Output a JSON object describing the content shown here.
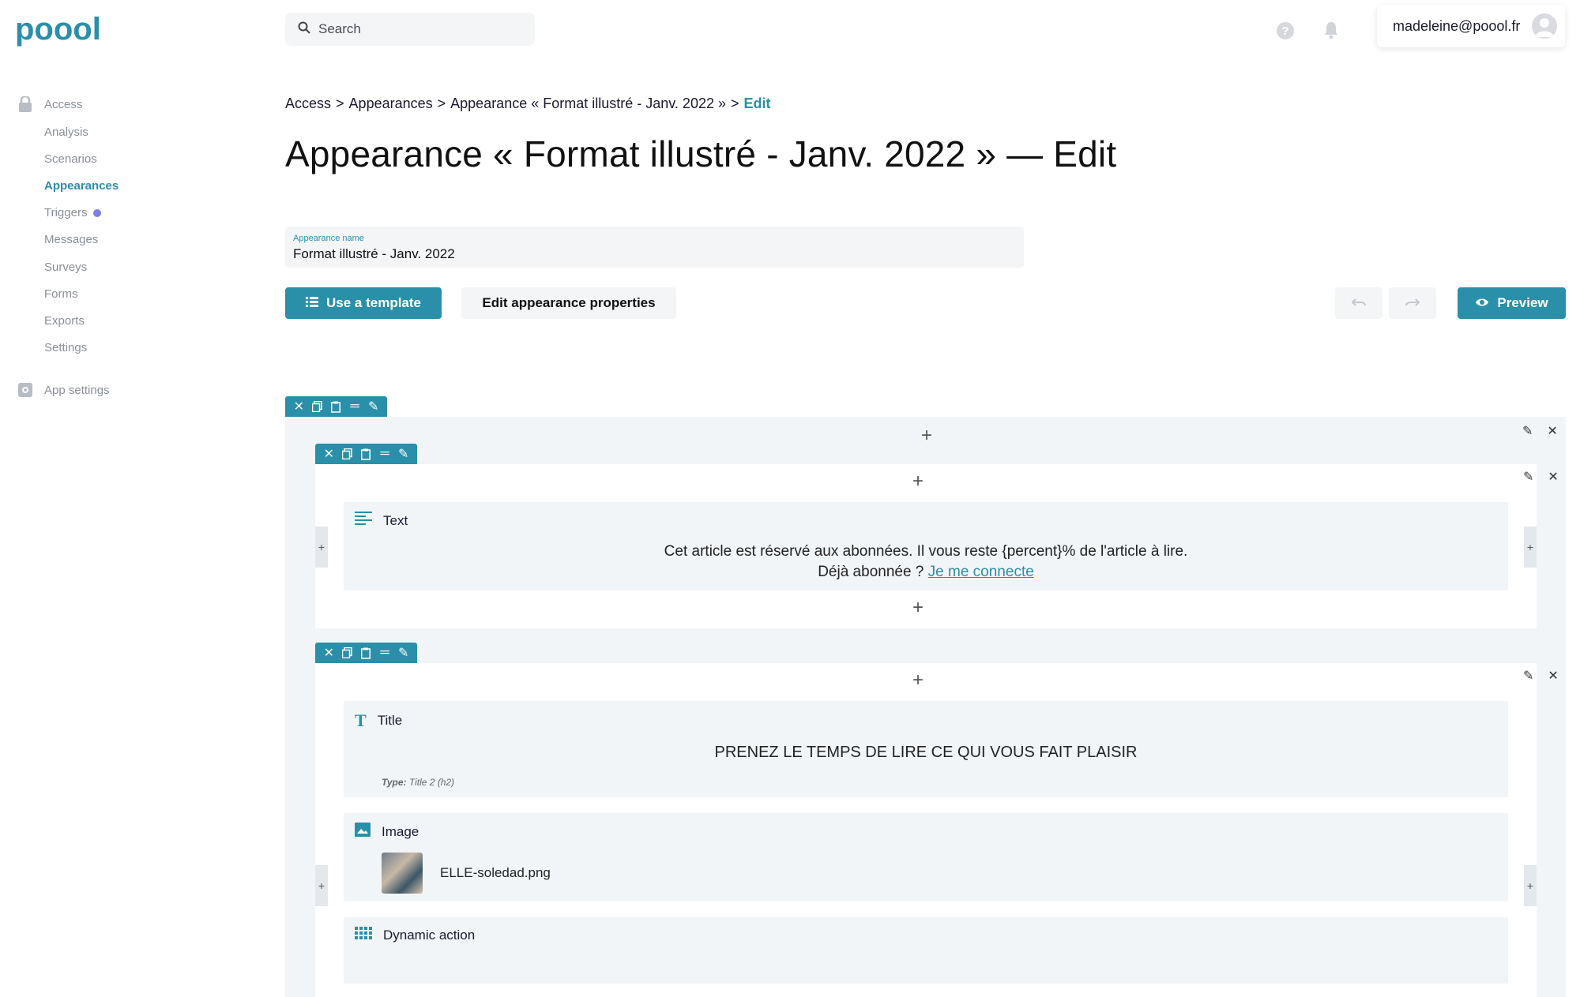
{
  "brand": {
    "logo_text": "poool",
    "accent": "#2a8fa8"
  },
  "sidebar": {
    "group_access": {
      "label": "Access",
      "icon": "lock-icon"
    },
    "items": [
      {
        "label": "Analysis"
      },
      {
        "label": "Scenarios"
      },
      {
        "label": "Appearances",
        "active": true
      },
      {
        "label": "Triggers",
        "badge": "dot"
      },
      {
        "label": "Messages"
      },
      {
        "label": "Surveys"
      },
      {
        "label": "Forms"
      },
      {
        "label": "Exports"
      },
      {
        "label": "Settings"
      }
    ],
    "group_app": {
      "label": "App settings",
      "icon": "gear-icon"
    }
  },
  "topbar": {
    "search_placeholder": "Search",
    "help_icon": "question-icon",
    "bell_icon": "bell-icon",
    "user_email": "madeleine@poool.fr"
  },
  "breadcrumb": {
    "items": [
      "Access",
      "Appearances",
      "Appearance « Format illustré - Janv. 2022 »"
    ],
    "separator": ">",
    "current": "Edit"
  },
  "page": {
    "title": "Appearance « Format illustré - Janv. 2022 » — Edit",
    "name_field": {
      "label": "Appearance name",
      "value": "Format illustré - Janv. 2022"
    }
  },
  "actions": {
    "use_template": "Use a template",
    "edit_properties": "Edit appearance properties",
    "preview": "Preview"
  },
  "editor": {
    "blocks": [
      {
        "label": "Text",
        "icon": "text-align-icon",
        "line1": "Cet article est réservé aux abonnées. Il vous reste {percent}% de l'article à lire.",
        "line2_prefix": "Déjà abonnée ? ",
        "link": "Je me connecte"
      },
      {
        "label": "Title",
        "icon": "title-icon",
        "text": "PRENEZ LE TEMPS DE LIRE CE QUI VOUS FAIT PLAISIR",
        "type_label": "Type:",
        "type_value": "Title 2 (h2)"
      },
      {
        "label": "Image",
        "icon": "image-icon",
        "filename": "ELLE-soledad.png"
      },
      {
        "label": "Dynamic action",
        "icon": "grid-icon"
      }
    ]
  }
}
